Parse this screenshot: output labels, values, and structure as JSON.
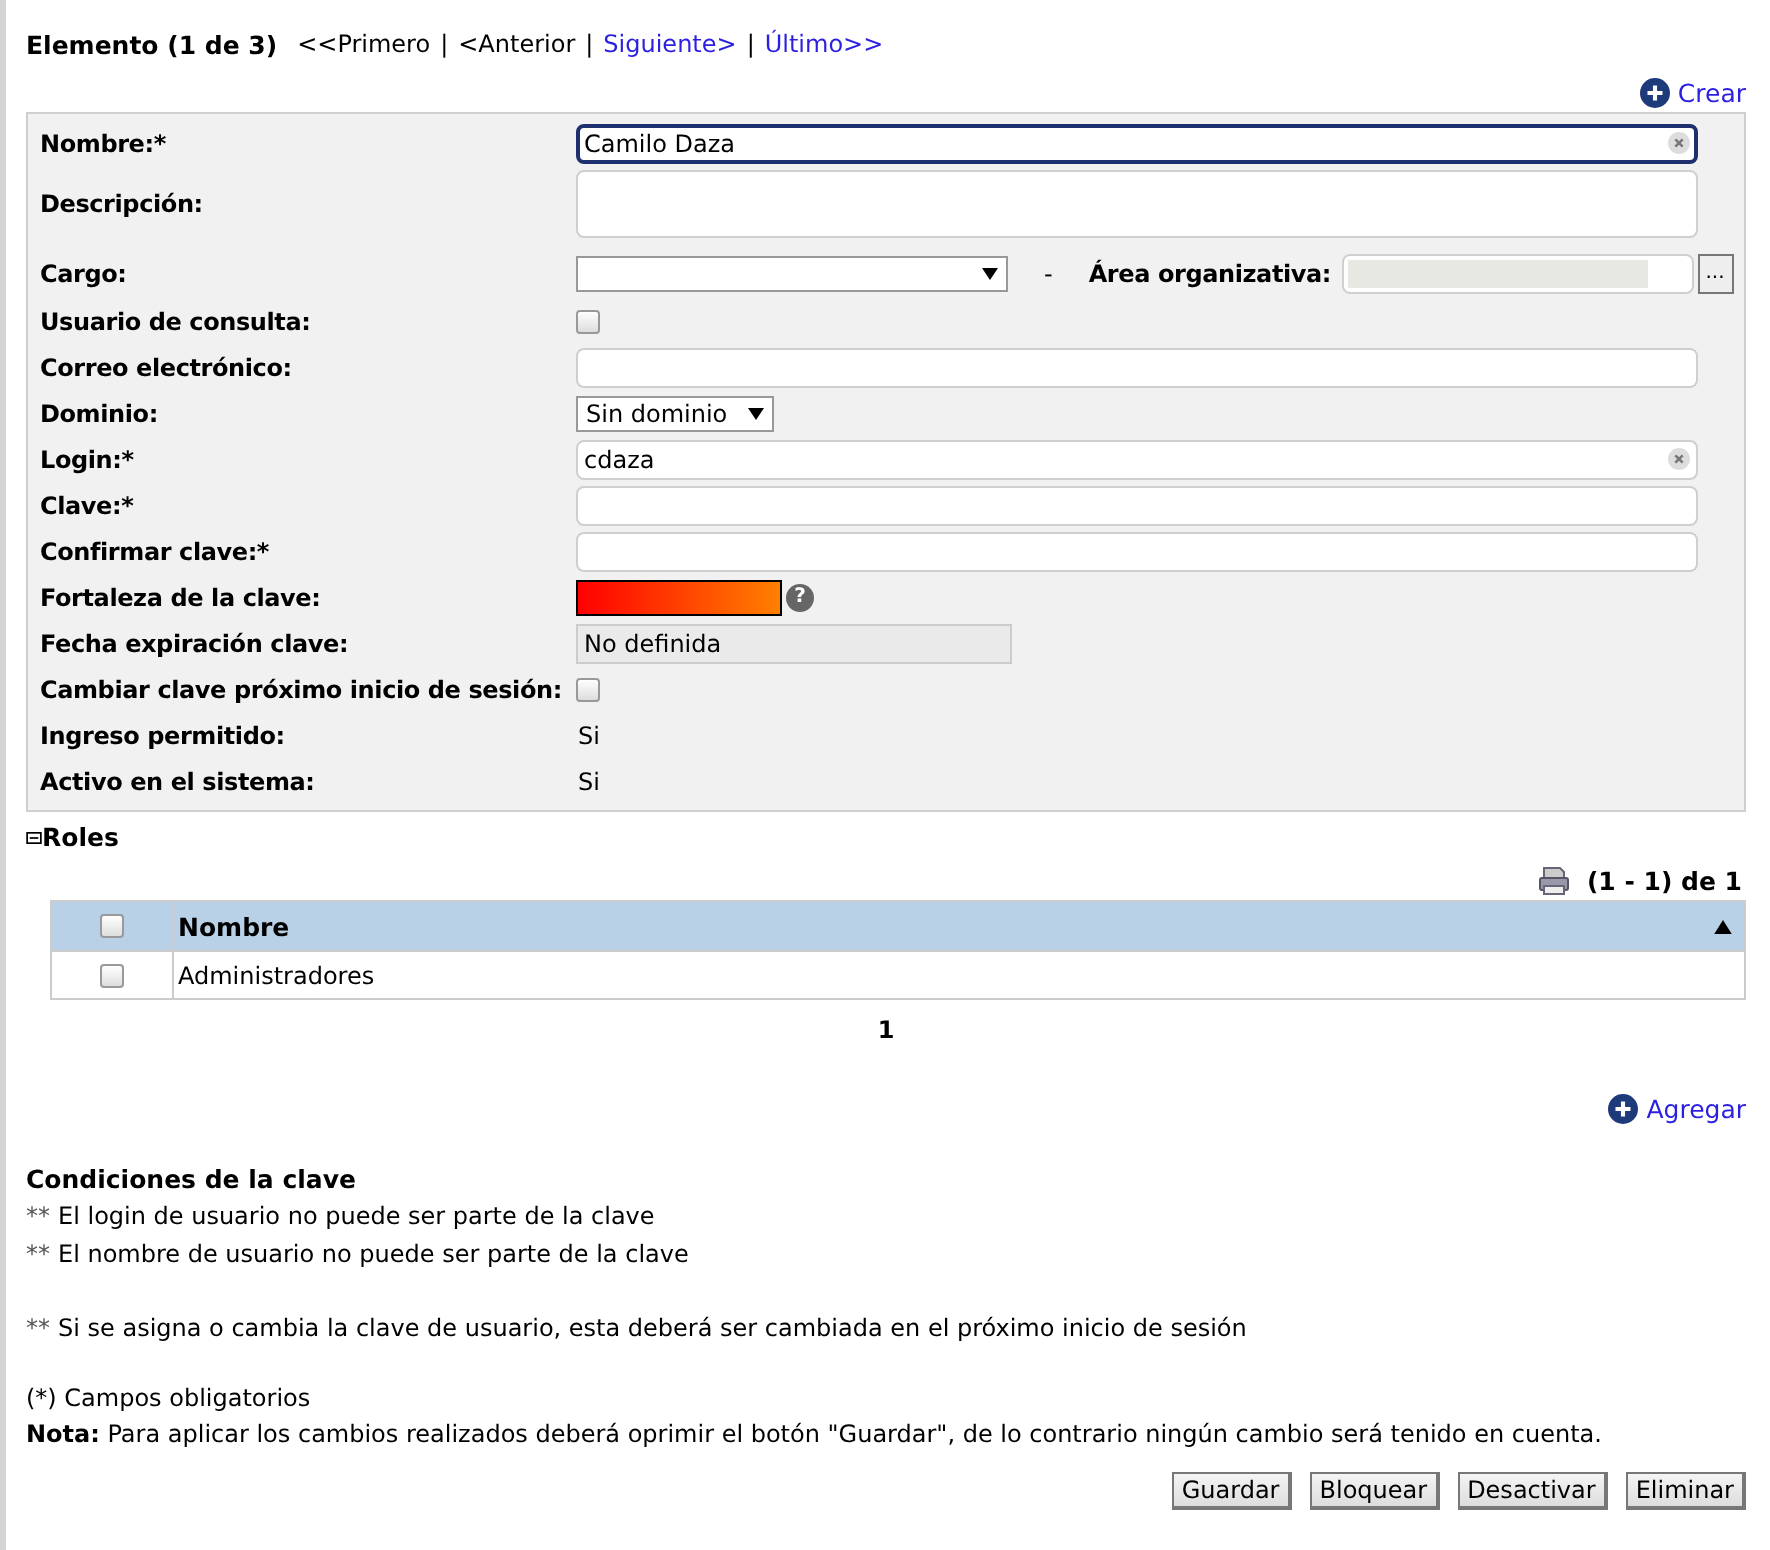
{
  "header": {
    "title": "Elemento (1 de 3)",
    "separator": "|",
    "nav": [
      {
        "label": "<<Primero",
        "enabled": false
      },
      {
        "label": "<Anterior",
        "enabled": false
      },
      {
        "label": "Siguiente>",
        "enabled": true
      },
      {
        "label": "Último>>",
        "enabled": true
      }
    ]
  },
  "create_link": "Crear",
  "form": {
    "fields": [
      {
        "kind": "text",
        "label": "Nombre:*",
        "value": "Camilo Daza",
        "clearable": true,
        "focused": true
      },
      {
        "kind": "textarea",
        "label": "Descripción:"
      },
      {
        "kind": "cargo",
        "label": "Cargo:",
        "separator": "-",
        "area_label": "Área organizativa:",
        "browse": "..."
      },
      {
        "kind": "checkbox",
        "label": "Usuario de consulta:",
        "checked": false
      },
      {
        "kind": "text",
        "label": "Correo electrónico:",
        "clearable": false,
        "focused": false
      },
      {
        "kind": "select",
        "label": "Dominio:",
        "value": "Sin dominio"
      },
      {
        "kind": "text",
        "label": "Login:*",
        "value": "cdaza",
        "clearable": true,
        "focused": false
      },
      {
        "kind": "text",
        "label": "Clave:*",
        "clearable": false,
        "focused": false
      },
      {
        "kind": "text",
        "label": "Confirmar clave:*",
        "clearable": false,
        "focused": false
      },
      {
        "kind": "strength",
        "label": "Fortaleza de la clave:",
        "level": 1,
        "help": "?"
      },
      {
        "kind": "readonly",
        "label": "Fecha expiración clave:",
        "value": "No definida"
      },
      {
        "kind": "checkbox",
        "label": "Cambiar clave próximo inicio de sesión:",
        "checked": false
      },
      {
        "kind": "plain",
        "label": "Ingreso permitido:",
        "value": "Si"
      },
      {
        "kind": "plain",
        "label": "Activo en el sistema:",
        "value": "Si"
      }
    ]
  },
  "roles": {
    "title": "Roles",
    "expanded": true,
    "count": "(1 - 1) de 1",
    "select_all": false,
    "columns": [
      {
        "label": "Nombre",
        "sort_ascending": true
      }
    ],
    "rows": [
      {
        "name": "Administradores",
        "checked": false
      }
    ],
    "pages": [
      "1"
    ],
    "add_link": "Agregar"
  },
  "conditions": {
    "title": "Condiciones de la clave",
    "groups": [
      [
        {
          "marker": "**",
          "text": "El login de usuario no puede ser parte de la clave"
        },
        {
          "marker": "**",
          "text": "El nombre de usuario no puede ser parte de la clave"
        }
      ],
      [
        {
          "marker": "**",
          "text": "Si se asigna o cambia la clave de usuario, esta deberá ser cambiada en el próximo inicio de sesión"
        }
      ]
    ]
  },
  "required_note": "(*) Campos obligatorios",
  "note": "**Nota:** Para aplicar los cambios realizados deberá oprimir el botón \"Guardar\", de lo contrario ningún cambio será tenido en cuenta.",
  "buttons": [
    "Guardar",
    "Bloquear",
    "Desactivar",
    "Eliminar"
  ]
}
